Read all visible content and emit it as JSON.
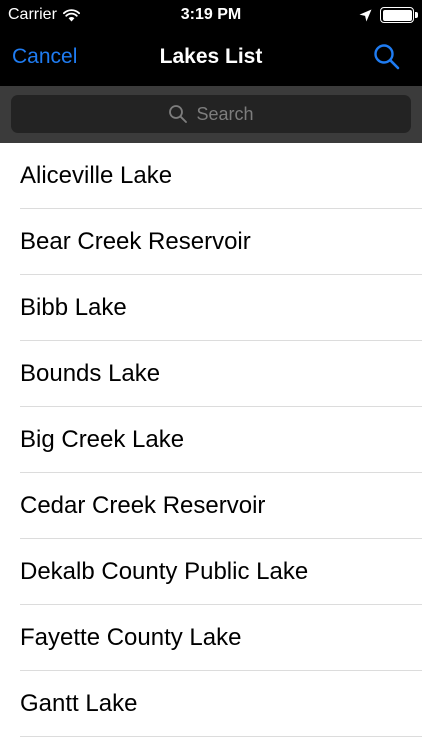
{
  "status_bar": {
    "carrier": "Carrier",
    "time": "3:19 PM",
    "icons": [
      "wifi-icon",
      "location-arrow-icon",
      "battery-icon"
    ],
    "battery_level": 1.0
  },
  "nav_bar": {
    "cancel_label": "Cancel",
    "title": "Lakes List",
    "search_icon": "search-icon"
  },
  "search": {
    "placeholder": "Search",
    "icon": "magnifier-icon"
  },
  "lakes": [
    {
      "name": "Aliceville Lake"
    },
    {
      "name": "Bear Creek Reservoir"
    },
    {
      "name": "Bibb Lake"
    },
    {
      "name": "Bounds Lake"
    },
    {
      "name": "Big Creek Lake"
    },
    {
      "name": "Cedar Creek Reservoir"
    },
    {
      "name": "Dekalb County Public Lake"
    },
    {
      "name": "Fayette County Lake"
    },
    {
      "name": "Gantt Lake"
    }
  ],
  "colors": {
    "accent": "#1f7cf2",
    "bar_background": "#000000",
    "search_area": "#3b3b3b",
    "search_field": "#232323",
    "placeholder": "#7d7d7d",
    "separator": "#dcdcdc"
  }
}
